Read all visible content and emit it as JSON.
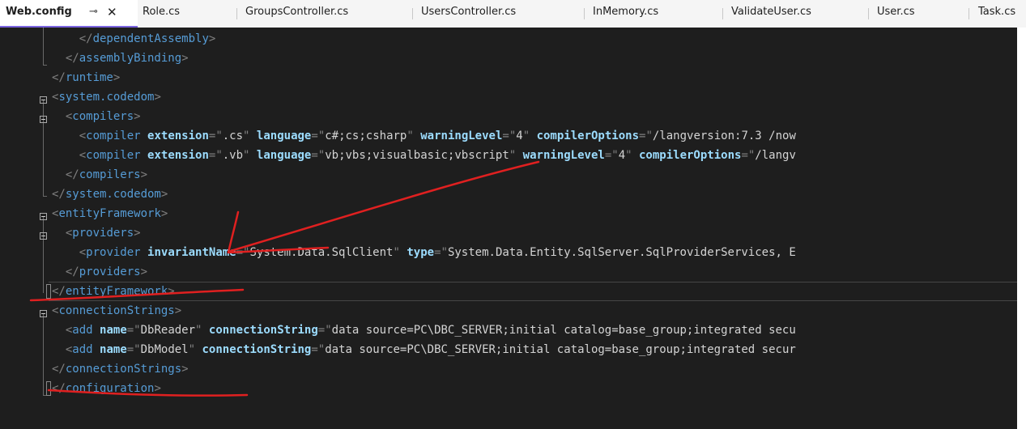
{
  "tabs": [
    {
      "label": "Web.config",
      "active": true
    },
    {
      "label": "Role.cs"
    },
    {
      "label": "GroupsController.cs"
    },
    {
      "label": "UsersController.cs"
    },
    {
      "label": "InMemory.cs"
    },
    {
      "label": "ValidateUser.cs"
    },
    {
      "label": "User.cs"
    },
    {
      "label": "Task.cs"
    }
  ],
  "tab_pin_glyph": "⊸",
  "tab_close_glyph": "✕",
  "code": {
    "l1": {
      "indent": "    ",
      "open": "</",
      "name": "dependentAssembly",
      "close": ">"
    },
    "l2": {
      "indent": "  ",
      "open": "</",
      "name": "assemblyBinding",
      "close": ">"
    },
    "l3": {
      "indent": "",
      "open": "</",
      "name": "runtime",
      "close": ">"
    },
    "l4": {
      "indent": "",
      "open": "<",
      "name": "system.codedom",
      "close": ">"
    },
    "l5": {
      "indent": "  ",
      "open": "<",
      "name": "compilers",
      "close": ">"
    },
    "l6": {
      "indent": "    ",
      "open": "<",
      "name": "compiler",
      "a1": "extension",
      "v1": ".cs",
      "a2": "language",
      "v2": "c#;cs;csharp",
      "a3": "warningLevel",
      "v3": "4",
      "a4": "compilerOptions",
      "v4": "/langversion:7.3 /now"
    },
    "l7": {
      "indent": "    ",
      "open": "<",
      "name": "compiler",
      "a1": "extension",
      "v1": ".vb",
      "a2": "language",
      "v2": "vb;vbs;visualbasic;vbscript",
      "a3": "warningLevel",
      "v3": "4",
      "a4": "compilerOptions",
      "v4": "/langv"
    },
    "l8": {
      "indent": "  ",
      "open": "</",
      "name": "compilers",
      "close": ">"
    },
    "l9": {
      "indent": "",
      "open": "</",
      "name": "system.codedom",
      "close": ">"
    },
    "l10": {
      "indent": "",
      "open": "<",
      "name": "entityFramework",
      "close": ">"
    },
    "l11": {
      "indent": "  ",
      "open": "<",
      "name": "providers",
      "close": ">"
    },
    "l12": {
      "indent": "    ",
      "open": "<",
      "name": "provider",
      "a1": "invariantName",
      "v1": "System.Data.SqlClient",
      "a2": "type",
      "v2": "System.Data.Entity.SqlServer.SqlProviderServices, E"
    },
    "l13": {
      "indent": "  ",
      "open": "</",
      "name": "providers",
      "close": ">"
    },
    "l14": {
      "indent": "",
      "open": "</",
      "name": "entityFramework",
      "close": ">"
    },
    "l15": {
      "indent": "",
      "open": "<",
      "name": "connectionStrings",
      "close": ">"
    },
    "l16": {
      "indent": "  ",
      "open": "<",
      "name": "add",
      "a1": "name",
      "v1": "DbReader",
      "a2": "connectionString",
      "v2": "data source=PC\\DBC_SERVER;initial catalog=base_group;integrated secu"
    },
    "l17": {
      "indent": "  ",
      "open": "<",
      "name": "add",
      "a1": "name",
      "v1": "DbModel",
      "a2": "connectionString",
      "v2": "data source=PC\\DBC_SERVER;initial catalog=base_group;integrated secur"
    },
    "l18": {
      "indent": "",
      "open": "</",
      "name": "connectionStrings",
      "close": ">"
    },
    "l19": {
      "indent": "",
      "open": "</",
      "name": "configuration",
      "close": ">"
    }
  },
  "syntax_colors": {
    "tag": "#569cd6",
    "attribute": "#9cdcfe",
    "punctuation": "#808080",
    "string": "#d4d4d4",
    "background": "#1e1e1e"
  },
  "annotation_color": "#e02020",
  "active_tab_accent": "#7b65e0"
}
